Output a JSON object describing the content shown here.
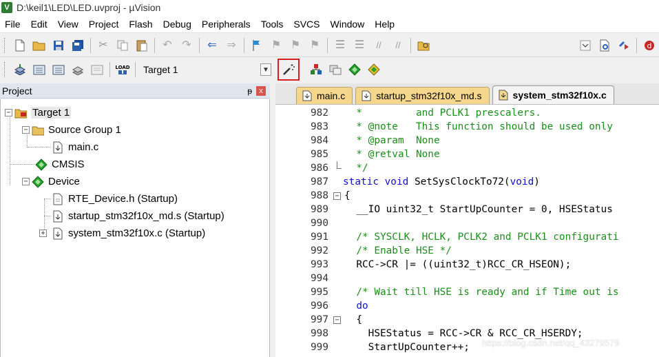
{
  "window": {
    "title": "D:\\keil1\\LED\\LED.uvproj - µVision"
  },
  "menu": [
    "File",
    "Edit",
    "View",
    "Project",
    "Flash",
    "Debug",
    "Peripherals",
    "Tools",
    "SVCS",
    "Window",
    "Help"
  ],
  "toolbar2": {
    "target_value": "Target 1"
  },
  "project_panel": {
    "title": "Project",
    "pin": "ᵽ",
    "close": "x"
  },
  "tree": [
    {
      "label": "Target 1",
      "icon": "target-folder-icon",
      "expander": "−"
    },
    {
      "label": "Source Group 1",
      "icon": "folder-icon",
      "expander": "−"
    },
    {
      "label": "main.c",
      "icon": "c-file-icon"
    },
    {
      "label": "CMSIS",
      "icon": "green-diamond-icon"
    },
    {
      "label": "Device",
      "icon": "green-diamond-icon",
      "expander": "−"
    },
    {
      "label": "RTE_Device.h (Startup)",
      "icon": "header-file-icon"
    },
    {
      "label": "startup_stm32f10x_md.s (Startup)",
      "icon": "asm-file-icon"
    },
    {
      "label": "system_stm32f10x.c (Startup)",
      "icon": "c-file-icon",
      "expander": "+"
    }
  ],
  "tabs": [
    {
      "label": "main.c",
      "active": false
    },
    {
      "label": "startup_stm32f10x_md.s",
      "active": false
    },
    {
      "label": "system_stm32f10x.c",
      "active": true
    }
  ],
  "code_lines": [
    {
      "n": "982",
      "text": "  *         and PCLK1 prescalers.",
      "kind": "comment"
    },
    {
      "n": "983",
      "text": "  * @note   This function should be used only",
      "kind": "comment"
    },
    {
      "n": "984",
      "text": "  * @param  None",
      "kind": "comment"
    },
    {
      "n": "985",
      "text": "  * @retval None",
      "kind": "comment"
    },
    {
      "n": "986",
      "text": "  */",
      "kind": "comment"
    },
    {
      "n": "987",
      "kw1": "static void",
      "mid": " SetSysClockTo72(",
      "kw2": "void",
      "end": ")",
      "kind": "decl"
    },
    {
      "n": "988",
      "text": "{",
      "kind": "plain"
    },
    {
      "n": "989",
      "text": "  __IO uint32_t StartUpCounter = 0, HSEStatus",
      "kind": "plain"
    },
    {
      "n": "990",
      "text": "",
      "kind": "plain"
    },
    {
      "n": "991",
      "text": "  /* SYSCLK, HCLK, PCLK2 and PCLK1 configurati",
      "kind": "comment"
    },
    {
      "n": "992",
      "text": "  /* Enable HSE */",
      "kind": "comment"
    },
    {
      "n": "993",
      "text": "  RCC->CR |= ((uint32_t)RCC_CR_HSEON);",
      "kind": "plain"
    },
    {
      "n": "994",
      "text": "",
      "kind": "plain"
    },
    {
      "n": "995",
      "text": "  /* Wait till HSE is ready and if Time out is",
      "kind": "comment"
    },
    {
      "n": "996",
      "text": "  do",
      "kind": "kw"
    },
    {
      "n": "997",
      "text": "  {",
      "kind": "plain"
    },
    {
      "n": "998",
      "text": "    HSEStatus = RCC->CR & RCC_CR_HSERDY;",
      "kind": "plain"
    },
    {
      "n": "999",
      "text": "    StartUpCounter++;",
      "kind": "plain"
    }
  ],
  "watermark": "https://blog.csdn.net/qq_43279579",
  "colors": {
    "comment": "#1b8f1b",
    "keyword": "#1010c8",
    "highlight_box": "#d81e1e",
    "tab_inactive": "#f4d68c"
  }
}
